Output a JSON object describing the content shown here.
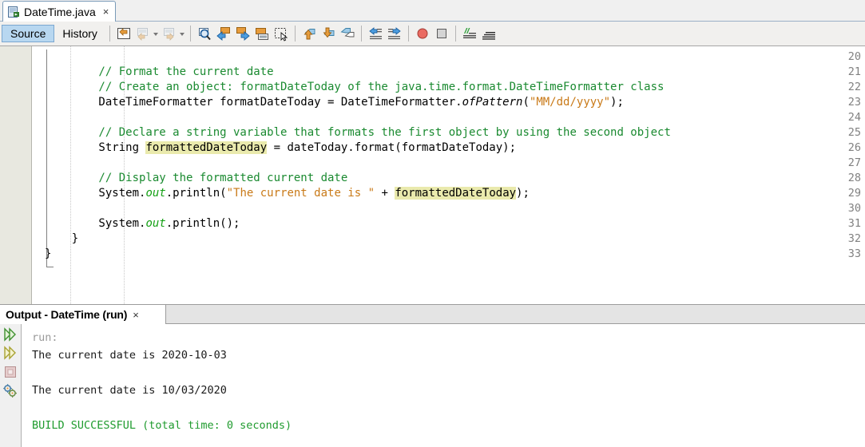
{
  "window": {
    "document_tab": {
      "title": "DateTime.java",
      "icon": "java-file-icon",
      "close_label": "×"
    }
  },
  "mode_tabs": [
    {
      "label": "Source",
      "selected": true
    },
    {
      "label": "History",
      "selected": false
    }
  ],
  "toolbar": {
    "groups": [
      {
        "buttons": [
          {
            "icon": "last-edit-icon",
            "enabled": true,
            "dropdown": false
          },
          {
            "icon": "back-navigate-icon",
            "enabled": false,
            "dropdown": true
          },
          {
            "icon": "forward-navigate-icon",
            "enabled": false,
            "dropdown": true
          }
        ]
      },
      {
        "buttons": [
          {
            "icon": "find-selection-icon",
            "enabled": true,
            "dropdown": false
          },
          {
            "icon": "find-previous-icon",
            "enabled": true,
            "dropdown": false
          },
          {
            "icon": "find-next-icon",
            "enabled": true,
            "dropdown": false
          },
          {
            "icon": "toggle-highlight-icon",
            "enabled": true,
            "dropdown": false
          },
          {
            "icon": "toggle-rectangular-selection-icon",
            "enabled": true,
            "dropdown": false
          }
        ]
      },
      {
        "buttons": [
          {
            "icon": "previous-bookmark-icon",
            "enabled": true,
            "dropdown": false
          },
          {
            "icon": "next-bookmark-icon",
            "enabled": true,
            "dropdown": false
          },
          {
            "icon": "toggle-bookmark-icon",
            "enabled": true,
            "dropdown": false
          }
        ]
      },
      {
        "buttons": [
          {
            "icon": "shift-line-left-icon",
            "enabled": true,
            "dropdown": false
          },
          {
            "icon": "shift-line-right-icon",
            "enabled": true,
            "dropdown": false
          }
        ]
      },
      {
        "buttons": [
          {
            "icon": "start-macro-recording-icon",
            "enabled": true,
            "dropdown": false
          },
          {
            "icon": "stop-macro-recording-icon",
            "enabled": true,
            "dropdown": false
          }
        ]
      },
      {
        "buttons": [
          {
            "icon": "comment-icon",
            "enabled": true,
            "dropdown": false
          },
          {
            "icon": "uncomment-icon",
            "enabled": true,
            "dropdown": false
          }
        ]
      }
    ]
  },
  "editor": {
    "first_line_number": 20,
    "line_numbers": [
      20,
      21,
      22,
      23,
      24,
      25,
      26,
      27,
      28,
      29,
      30,
      31,
      32,
      33
    ],
    "lines": [
      {
        "n": 20,
        "segments": []
      },
      {
        "n": 21,
        "segments": [
          {
            "text": "        // Format the current date",
            "cls": "cm"
          }
        ]
      },
      {
        "n": 22,
        "segments": [
          {
            "text": "        // Create an object: formatDateToday of the java.time.format.DateTimeFormatter class",
            "cls": "cm"
          }
        ]
      },
      {
        "n": 23,
        "segments": [
          {
            "text": "        DateTimeFormatter formatDateToday = DateTimeFormatter.",
            "cls": "plain"
          },
          {
            "text": "ofPattern",
            "cls": "mtd"
          },
          {
            "text": "(",
            "cls": "plain"
          },
          {
            "text": "\"MM/dd/yyyy\"",
            "cls": "str"
          },
          {
            "text": ");",
            "cls": "plain"
          }
        ]
      },
      {
        "n": 24,
        "segments": []
      },
      {
        "n": 25,
        "segments": [
          {
            "text": "        // Declare a string variable that formats the first object by using the second object",
            "cls": "cm"
          }
        ]
      },
      {
        "n": 26,
        "segments": [
          {
            "text": "        String ",
            "cls": "plain"
          },
          {
            "text": "formattedDateToday",
            "cls": "plain hl"
          },
          {
            "text": " = dateToday.format(formatDateToday);",
            "cls": "plain"
          }
        ]
      },
      {
        "n": 27,
        "segments": []
      },
      {
        "n": 28,
        "segments": [
          {
            "text": "        // Display the formatted current date",
            "cls": "cm"
          }
        ]
      },
      {
        "n": 29,
        "segments": [
          {
            "text": "        System.",
            "cls": "plain"
          },
          {
            "text": "out",
            "cls": "stat"
          },
          {
            "text": ".println(",
            "cls": "plain"
          },
          {
            "text": "\"The current date is \"",
            "cls": "str"
          },
          {
            "text": " + ",
            "cls": "plain"
          },
          {
            "text": "formattedDateToday",
            "cls": "plain hl"
          },
          {
            "text": ");",
            "cls": "plain"
          }
        ]
      },
      {
        "n": 30,
        "segments": []
      },
      {
        "n": 31,
        "segments": [
          {
            "text": "        System.",
            "cls": "plain"
          },
          {
            "text": "out",
            "cls": "stat"
          },
          {
            "text": ".println();",
            "cls": "plain"
          }
        ]
      },
      {
        "n": 32,
        "segments": [
          {
            "text": "    }",
            "cls": "plain"
          }
        ]
      },
      {
        "n": 33,
        "segments": [
          {
            "text": "}",
            "cls": "plain"
          }
        ]
      }
    ]
  },
  "output": {
    "tab": {
      "title": "Output - DateTime (run)",
      "close_label": "×"
    },
    "gutter_icons": [
      {
        "icon": "run-icon",
        "name": "rerun-green"
      },
      {
        "icon": "rerun-icon",
        "name": "rerun-yellow"
      },
      {
        "icon": "stop-icon",
        "name": "stop-disabled"
      },
      {
        "icon": "build-gears-icon",
        "name": "gears"
      }
    ],
    "lines": [
      {
        "text": "run:",
        "cls": "o-gray"
      },
      {
        "text": "The current date is 2020-10-03",
        "cls": "o-black"
      },
      {
        "text": "",
        "cls": "o-black"
      },
      {
        "text": "The current date is 10/03/2020",
        "cls": "o-black"
      },
      {
        "text": "",
        "cls": "o-black"
      },
      {
        "text": "BUILD SUCCESSFUL (total time: 0 seconds)",
        "cls": "o-green"
      }
    ]
  },
  "colors": {
    "comment_green": "#1a8a30",
    "string_orange": "#c97a18",
    "static_field_green": "#14a014",
    "highlight_yellow": "#eaeaad",
    "selected_tab_blue": "#b8d7f0",
    "build_success_green": "#1f9b2e",
    "gutter_bg": "#e8e8e0"
  }
}
